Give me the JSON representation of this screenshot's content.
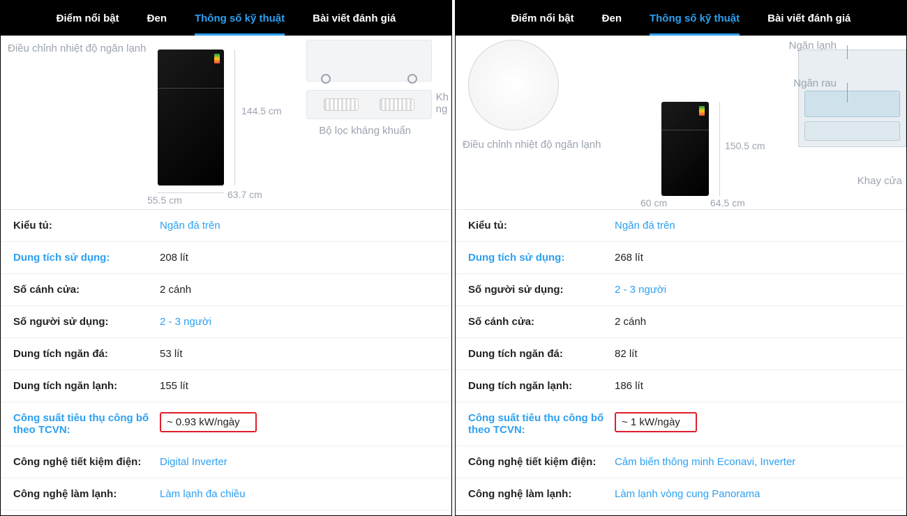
{
  "tabs": [
    "Điểm nổi bật",
    "Đen",
    "Thông số kỹ thuật",
    "Bài viết đánh giá"
  ],
  "active_tab_index": 2,
  "left": {
    "hero": {
      "temp_adjust": "Điều chỉnh nhiệt độ ngăn lạnh",
      "filter": "Bộ lọc kháng khuẩn",
      "kh_ng": "Kh\nng",
      "height": "144.5 cm",
      "width": "55.5 cm",
      "depth": "63.7 cm"
    },
    "rows": [
      {
        "label": "Kiểu tủ:",
        "value": "Ngăn đá trên",
        "label_link": false,
        "value_link": true,
        "hl": false
      },
      {
        "label": "Dung tích sử dụng:",
        "value": "208 lít",
        "label_link": true,
        "value_link": false,
        "hl": false
      },
      {
        "label": "Số cánh cửa:",
        "value": "2 cánh",
        "label_link": false,
        "value_link": false,
        "hl": false
      },
      {
        "label": "Số người sử dụng:",
        "value": "2 - 3 người",
        "label_link": false,
        "value_link": true,
        "hl": false
      },
      {
        "label": "Dung tích ngăn đá:",
        "value": "53 lít",
        "label_link": false,
        "value_link": false,
        "hl": false
      },
      {
        "label": "Dung tích ngăn lạnh:",
        "value": "155 lít",
        "label_link": false,
        "value_link": false,
        "hl": false
      },
      {
        "label": "Công suất tiêu thụ công bố theo TCVN:",
        "value": "~ 0.93 kW/ngày",
        "label_link": true,
        "value_link": false,
        "hl": true
      },
      {
        "label": "Công nghệ tiết kiệm điện:",
        "value": "Digital Inverter",
        "label_link": false,
        "value_link": true,
        "hl": false
      },
      {
        "label": "Công nghệ làm lạnh:",
        "value": "Làm lạnh đa chiều",
        "label_link": false,
        "value_link": true,
        "hl": false
      }
    ]
  },
  "right": {
    "hero": {
      "temp_adjust": "Điều chỉnh nhiệt độ ngăn lạnh",
      "ngan_lanh": "Ngăn lạnh",
      "ngan_rau": "Ngăn rau",
      "khay_cua": "Khay cửa",
      "height": "150.5 cm",
      "width": "60 cm",
      "depth": "64.5 cm"
    },
    "rows": [
      {
        "label": "Kiểu tủ:",
        "value": "Ngăn đá trên",
        "label_link": false,
        "value_link": true,
        "hl": false
      },
      {
        "label": "Dung tích sử dụng:",
        "value": "268 lít",
        "label_link": true,
        "value_link": false,
        "hl": false
      },
      {
        "label": "Số người sử dụng:",
        "value": "2 - 3 người",
        "label_link": false,
        "value_link": true,
        "hl": false
      },
      {
        "label": "Số cánh cửa:",
        "value": "2 cánh",
        "label_link": false,
        "value_link": false,
        "hl": false
      },
      {
        "label": "Dung tích ngăn đá:",
        "value": "82 lít",
        "label_link": false,
        "value_link": false,
        "hl": false
      },
      {
        "label": "Dung tích ngăn lạnh:",
        "value": "186 lít",
        "label_link": false,
        "value_link": false,
        "hl": false
      },
      {
        "label": "Công suất tiêu thụ công bố theo TCVN:",
        "value": "~ 1 kW/ngày",
        "label_link": true,
        "value_link": false,
        "hl": true
      },
      {
        "label": "Công nghệ tiết kiệm điện:",
        "value": "Cảm biến thông minh Econavi, Inverter",
        "label_link": false,
        "value_link": true,
        "hl": false
      },
      {
        "label": "Công nghệ làm lạnh:",
        "value": "Làm lạnh vòng cung Panorama",
        "label_link": false,
        "value_link": true,
        "hl": false
      }
    ]
  }
}
